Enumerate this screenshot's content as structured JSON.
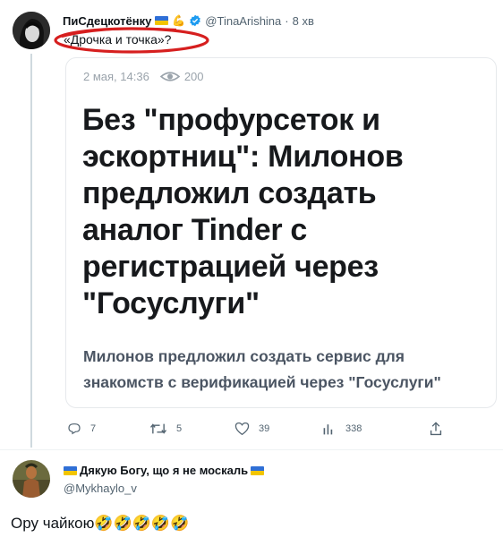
{
  "tweet": {
    "author_name": "ПиСдецкотёнку",
    "author_emoji": "💪",
    "author_handle": "@TinaArishina",
    "separator": "·",
    "time": "8 хв",
    "text": "«Дрочка и точка»?",
    "colors": {
      "highlight_ring": "#d61f1f",
      "verified": "#1d9bf0",
      "text": "#0f1419",
      "muted": "#536471"
    },
    "quoted_card": {
      "date": "2 мая, 14:36",
      "views": "200",
      "headline": [
        "Без \"профурсеток и",
        "эскортниц\": Милонов",
        "предложил создать",
        "аналог Tinder с",
        "регистрацией через",
        "\"Госуслуги\""
      ],
      "subtitle": [
        "Милонов предложил создать сервис для",
        "знакомств с верификацией через \"Госуслуги\""
      ]
    },
    "actions": {
      "replies": "7",
      "retweets": "5",
      "likes": "39",
      "views": "338"
    }
  },
  "reply": {
    "author_name": "Дякую Богу, що я не москаль",
    "author_handle": "@Mykhaylo_v",
    "text": "Ору чайкою🤣🤣🤣🤣🤣"
  }
}
